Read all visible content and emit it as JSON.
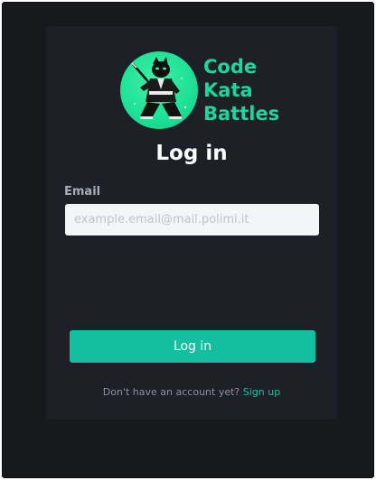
{
  "brand": {
    "line1": "Code",
    "line2": "Kata",
    "line3": "Battles",
    "logo_icon": "ninja-cat-logo-icon",
    "accent_color": "#1ed5a0"
  },
  "form": {
    "title": "Log in",
    "email_label": "Email",
    "email_placeholder": "example.email@mail.polimi.it",
    "email_value": "",
    "submit_label": "Log in",
    "button_color": "#14bfa0"
  },
  "footer": {
    "prompt": "Don't have an account yet?",
    "signup_label": "Sign up"
  }
}
